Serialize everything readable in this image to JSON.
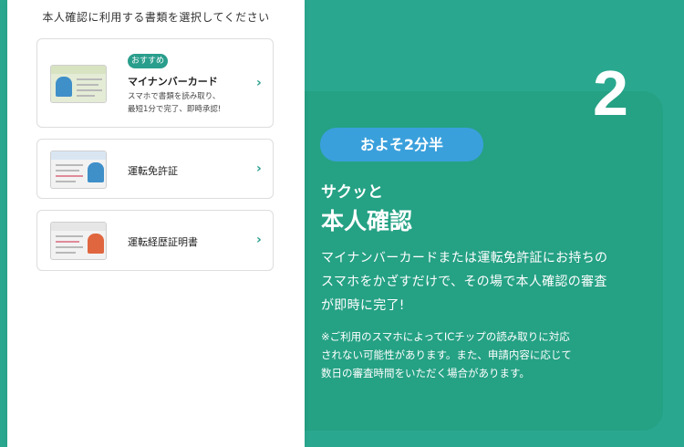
{
  "step": {
    "number": "2"
  },
  "left_panel": {
    "title": "本人確認に利用する書類を選択してください",
    "documents": [
      {
        "badge": "おすすめ",
        "name": "マイナンバーカード",
        "description_line1": "スマホで書類を読み取り、",
        "description_line2": "最短1分で完了、即時承認!"
      },
      {
        "name": "運転免許証"
      },
      {
        "name": "運転経歴証明書"
      }
    ],
    "chevron_glyph": "›"
  },
  "right_panel": {
    "duration": "およそ2分半",
    "subheading": "サクッと",
    "heading": "本人確認",
    "body_line1": "マイナンバーカードまたは運転免許証にお持ちの",
    "body_line2": "スマホをかざすだけで、その場で本人確認の審査",
    "body_line3": "が即時に完了!",
    "note_line1": "※ご利用のスマホによってICチップの読み取りに対応",
    "note_line2": "されない可能性があります。また、申請内容に応じて",
    "note_line3": "数日の審査時間をいただく場合があります。"
  },
  "colors": {
    "background": "#2aa88f",
    "panel": "#25a184",
    "accent_teal": "#2a9e8c",
    "pill_blue": "#3aa0dc"
  }
}
